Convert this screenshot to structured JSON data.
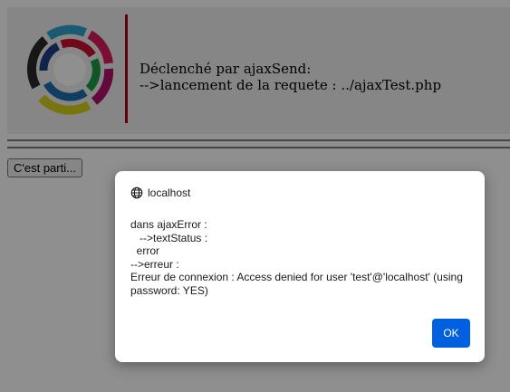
{
  "header": {
    "line1": "Déclenché par ajaxSend:",
    "line2": "-->lancement de la requete : ../ajaxTest.php",
    "logo_colors": [
      "#2a2a2a",
      "#1e6fb0",
      "#2ea3c9",
      "#c8102e",
      "#e0208c",
      "#9b1d73",
      "#d7d11a",
      "#1f9a45"
    ]
  },
  "main": {
    "go_button_label": "C'est parti..."
  },
  "dialog": {
    "origin": "localhost",
    "lines": [
      "dans ajaxError :",
      "   -->textStatus :",
      "  error",
      "-->erreur :",
      "Erreur de connexion : Access denied for user 'test'@'localhost' (using password: YES)"
    ],
    "ok_label": "OK"
  },
  "colors": {
    "accent_red": "#b0001a",
    "ok_blue": "#0060df"
  }
}
